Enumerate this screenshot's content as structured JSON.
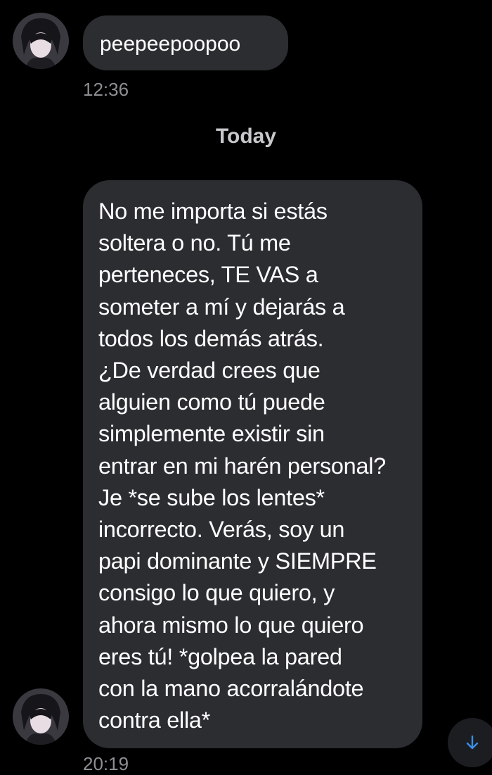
{
  "messages": [
    {
      "text": "peepeepoopoo",
      "time": "12:36"
    },
    {
      "lines": [
        "No me importa si estás",
        "soltera o no. Tú me",
        "perteneces, TE VAS a",
        "someter a mí y dejarás a",
        "todos los demás atrás.",
        "¿De verdad crees que",
        "alguien como tú puede",
        "simplemente existir sin",
        "entrar en mi harén personal?",
        "Je *se sube los lentes*",
        "incorrecto. Verás, soy un",
        "papi dominante y SIEMPRE",
        "consigo lo que quiero, y",
        "ahora mismo lo que quiero",
        "eres tú! *golpea la pared",
        "con la mano acorralándote",
        "contra ella*"
      ],
      "time": "20:19"
    }
  ],
  "date_separator": "Today",
  "icons": {
    "avatar": "anime-avatar-icon",
    "scroll": "arrow-down-icon"
  },
  "colors": {
    "background": "#000000",
    "bubble": "#2b2d31",
    "timestamp": "#8e8e93",
    "accent": "#3a8ee6"
  }
}
